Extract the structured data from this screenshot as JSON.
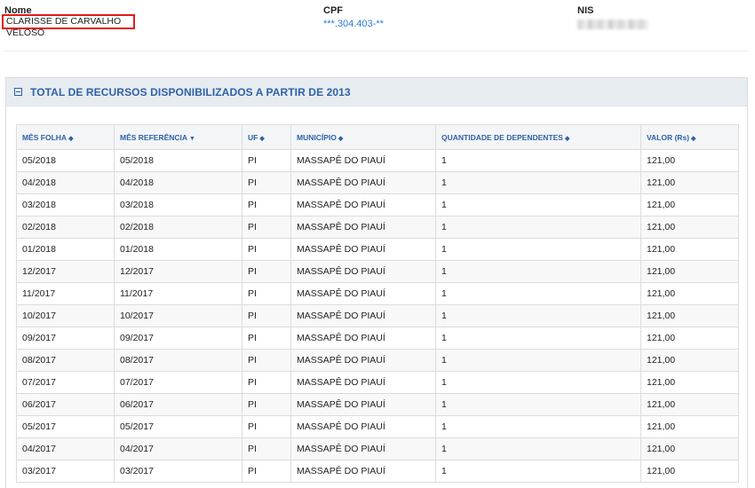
{
  "info": {
    "nome_label": "Nome",
    "nome_value": "CLARISSE DE CARVALHO VELOSO",
    "cpf_label": "CPF",
    "cpf_value": "***.304.403-**",
    "nis_label": "NIS"
  },
  "panel": {
    "title": "TOTAL DE RECURSOS DISPONIBILIZADOS A PARTIR DE 2013",
    "collapse_icon": "minus-square-icon"
  },
  "table": {
    "columns": [
      {
        "label": "MÊS FOLHA",
        "sort_icon": "◆"
      },
      {
        "label": "MÊS REFERÊNCIA",
        "sort_icon": "▼"
      },
      {
        "label": "UF",
        "sort_icon": "◆"
      },
      {
        "label": "MUNICÍPIO",
        "sort_icon": "◆"
      },
      {
        "label": "QUANTIDADE DE DEPENDENTES",
        "sort_icon": "◆"
      },
      {
        "label": "VALOR (Rs)",
        "sort_icon": "◆"
      }
    ],
    "rows": [
      [
        "05/2018",
        "05/2018",
        "PI",
        "MASSAPÊ DO PIAUÍ",
        "1",
        "121,00"
      ],
      [
        "04/2018",
        "04/2018",
        "PI",
        "MASSAPÊ DO PIAUÍ",
        "1",
        "121,00"
      ],
      [
        "03/2018",
        "03/2018",
        "PI",
        "MASSAPÊ DO PIAUÍ",
        "1",
        "121,00"
      ],
      [
        "02/2018",
        "02/2018",
        "PI",
        "MASSAPÊ DO PIAUÍ",
        "1",
        "121,00"
      ],
      [
        "01/2018",
        "01/2018",
        "PI",
        "MASSAPÊ DO PIAUÍ",
        "1",
        "121,00"
      ],
      [
        "12/2017",
        "12/2017",
        "PI",
        "MASSAPÊ DO PIAUÍ",
        "1",
        "121,00"
      ],
      [
        "11/2017",
        "11/2017",
        "PI",
        "MASSAPÊ DO PIAUÍ",
        "1",
        "121,00"
      ],
      [
        "10/2017",
        "10/2017",
        "PI",
        "MASSAPÊ DO PIAUÍ",
        "1",
        "121,00"
      ],
      [
        "09/2017",
        "09/2017",
        "PI",
        "MASSAPÊ DO PIAUÍ",
        "1",
        "121,00"
      ],
      [
        "08/2017",
        "08/2017",
        "PI",
        "MASSAPÊ DO PIAUÍ",
        "1",
        "121,00"
      ],
      [
        "07/2017",
        "07/2017",
        "PI",
        "MASSAPÊ DO PIAUÍ",
        "1",
        "121,00"
      ],
      [
        "06/2017",
        "06/2017",
        "PI",
        "MASSAPÊ DO PIAUÍ",
        "1",
        "121,00"
      ],
      [
        "05/2017",
        "05/2017",
        "PI",
        "MASSAPÊ DO PIAUÍ",
        "1",
        "121,00"
      ],
      [
        "04/2017",
        "04/2017",
        "PI",
        "MASSAPÊ DO PIAUÍ",
        "1",
        "121,00"
      ],
      [
        "03/2017",
        "03/2017",
        "PI",
        "MASSAPÊ DO PIAUÍ",
        "1",
        "121,00"
      ]
    ]
  },
  "colors": {
    "accent": "#2f62a8",
    "highlight_border": "#e01b1b",
    "cpf_link": "#2a7bd1",
    "header_bg": "#e7ecf1"
  }
}
